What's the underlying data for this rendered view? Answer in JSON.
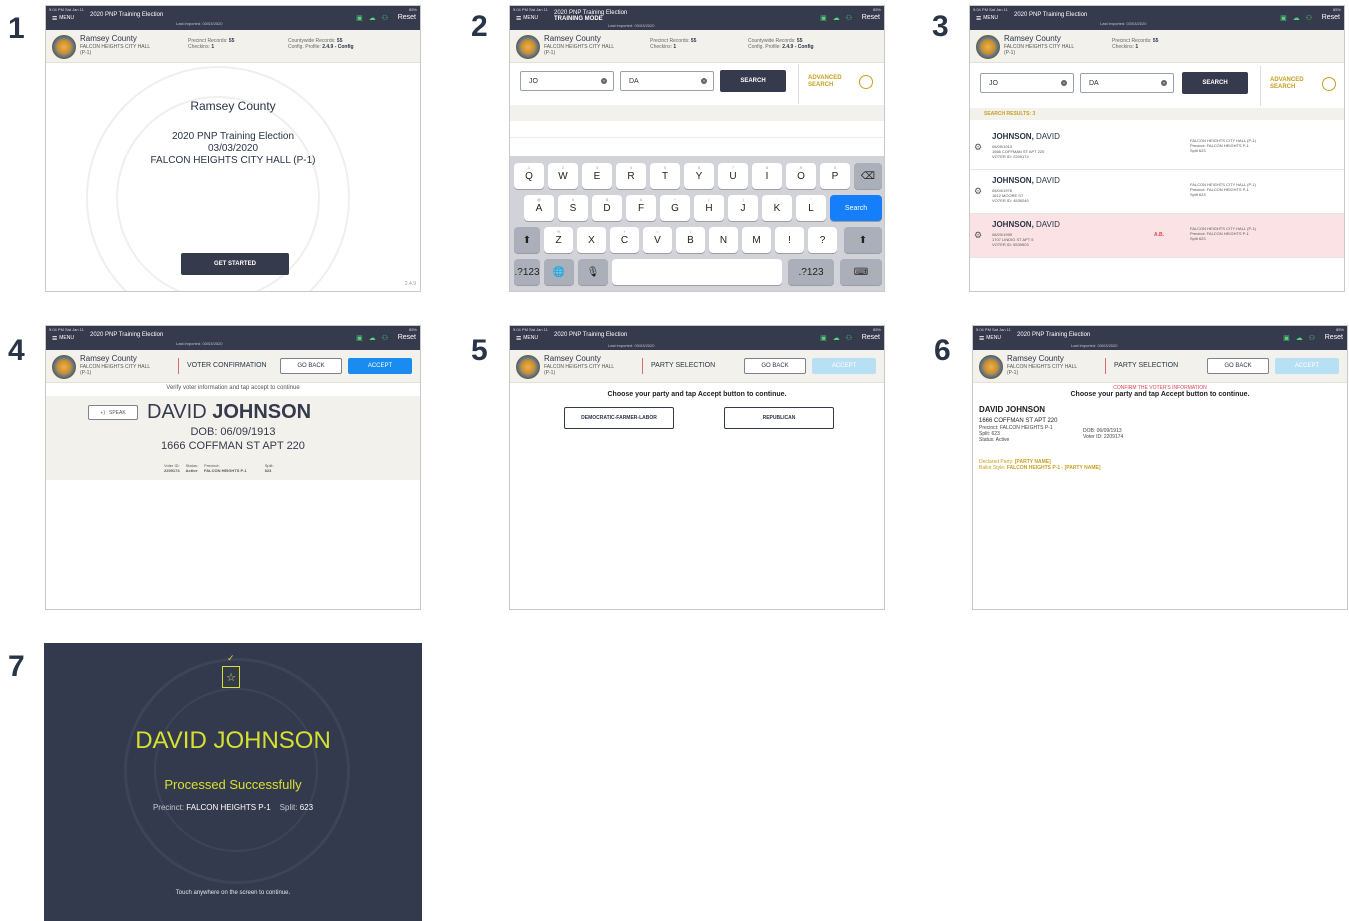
{
  "step_numbers": [
    "1",
    "2",
    "3",
    "4",
    "5",
    "6",
    "7"
  ],
  "common": {
    "status_time": "5:04 PM  Sat Jan 11",
    "status_battery": "85%",
    "menu": "MENU",
    "election": "2020 PNP Training Election",
    "training_mode": "TRAINING MODE",
    "last_imported": "Last imported: 03/03/2020",
    "reset": "Reset",
    "county": "Ramsey County",
    "location": "FALCON HEIGHTS CITY HALL",
    "location_sub": "(P-1)",
    "precinct_records_label": "Precinct Records:",
    "precinct_records": "55",
    "checkins_label": "Checkins:",
    "checkins": "1",
    "countywide_label": "Countywide Records:",
    "countywide": "55",
    "config_label": "Config. Profile:",
    "config": "2.4.9 - Config",
    "go_back": "GO BACK",
    "accept": "ACCEPT"
  },
  "screen1": {
    "county": "Ramsey County",
    "election": "2020 PNP Training Election",
    "date": "03/03/2020",
    "location": "FALCON HEIGHTS CITY HALL (P-1)",
    "button": "GET STARTED",
    "version": "2.4.9"
  },
  "screen2": {
    "last_name": "JO",
    "first_name": "DA",
    "search": "SEARCH",
    "advanced_line1": "ADVANCED",
    "advanced_line2": "SEARCH",
    "row1": [
      "Q",
      "W",
      "E",
      "R",
      "T",
      "Y",
      "U",
      "I",
      "O",
      "P"
    ],
    "row1_sub": [
      "1",
      "2",
      "3",
      "4",
      "5",
      "6",
      "7",
      "8",
      "9",
      "0"
    ],
    "row2": [
      "A",
      "S",
      "D",
      "F",
      "G",
      "H",
      "J",
      "K",
      "L"
    ],
    "row2_sub": [
      "@",
      "#",
      "$",
      "&",
      "*",
      "(",
      ")",
      "'",
      "\""
    ],
    "row3": [
      "Z",
      "X",
      "C",
      "V",
      "B",
      "N",
      "M",
      "!",
      "?"
    ],
    "row3_sub": [
      "%",
      "-",
      "+",
      "=",
      "/",
      ";",
      ":",
      ",",
      "."
    ],
    "search_key": "Search",
    "num_key": ".?123",
    "globe_key": "🌐",
    "mic_key": "🎙"
  },
  "screen3": {
    "last_name": "JO",
    "first_name": "DA",
    "search": "SEARCH",
    "advanced_line1": "ADVANCED",
    "advanced_line2": "SEARCH",
    "results_label": "SEARCH RESULTS: 3",
    "voters": [
      {
        "last": "JOHNSON,",
        "first": "DAVID",
        "dob": "06/09/1913",
        "addr": "1666 COFFMAN ST APT 220",
        "id": "VOTER ID: 2209174",
        "ab": "",
        "pre1": "FALCON HEIGHTS CITY HALL (P-1)",
        "pre2": "Precinct: FALCON HEIGHTS P-1",
        "split": "Split 623"
      },
      {
        "last": "JOHNSON,",
        "first": "DAVID",
        "dob": "05/04/1976",
        "addr": "1612 MOORE ST",
        "id": "VOTER ID: 4539240",
        "ab": "",
        "pre1": "FALCON HEIGHTS CITY HALL (P-1)",
        "pre2": "Precinct: FALCON HEIGHTS P-1",
        "split": "Split 623"
      },
      {
        "last": "JOHNSON,",
        "first": "DAVID",
        "dob": "08/20/1959",
        "addr": "1707 LINDIG ST APT 5",
        "id": "VOTER ID: 5539503",
        "ab": "A.B.",
        "pre1": "FALCON HEIGHTS CITY HALL (P-1)",
        "pre2": "Precinct: FALCON HEIGHTS P-1",
        "split": "Split 623"
      }
    ]
  },
  "screen4": {
    "title": "VOTER CONFIRMATION",
    "instruction": "Verify voter information and tap accept to continue",
    "speak": "SPEAK",
    "first": "DAVID",
    "last": "JOHNSON",
    "dob": "DOB: 06/09/1913",
    "address": "1666 COFFMAN ST APT 220",
    "voterid_label": "Voter ID:",
    "voterid": "2209174",
    "status_label": "Status:",
    "status": "Active",
    "precinct_label": "Precinct:",
    "precinct": "FALCON HEIGHTS P-1",
    "split_label": "Split:",
    "split": "623"
  },
  "screen5": {
    "title": "PARTY SELECTION",
    "instruction": "Choose your party and tap Accept button to continue.",
    "party1": "DEMOCRATIC-FARMER-LABOR",
    "party2": "REPUBLICAN"
  },
  "screen6": {
    "title": "PARTY SELECTION",
    "confirm": "CONFIRM THE VOTER'S INFORMATION",
    "instruction": "Choose your party and tap Accept button to continue.",
    "name": "DAVID JOHNSON",
    "address": "1666 COFFMAN ST APT 220",
    "precinct_line": "Precinct: FALCON HEIGHTS P-1",
    "split_line": "Split: 623",
    "status_line": "Status: Active",
    "dob_line": "DOB: 06/09/1913",
    "voterid_line": "Voter ID: 2209174",
    "declared_label": "Declared Party:",
    "declared": "[PARTY NAME]",
    "ballot_label": "Ballot Style:",
    "ballot": "FALCON HEIGHTS P-1 - [PARTY NAME]"
  },
  "screen7": {
    "name": "DAVID JOHNSON",
    "processed": "Processed Successfully",
    "precinct_label": "Precinct:",
    "precinct": "FALCON HEIGHTS P-1",
    "split_label": "Split:",
    "split": "623",
    "touch": "Touch anywhere on the screen to continue."
  },
  "colors": {
    "topbar": "#353a4c",
    "accent_blue": "#1a8cf0",
    "disabled_blue": "#b7e0f5",
    "gold": "#c8a020",
    "success_yellow": "#d6e031",
    "alert_red": "#e04050"
  }
}
